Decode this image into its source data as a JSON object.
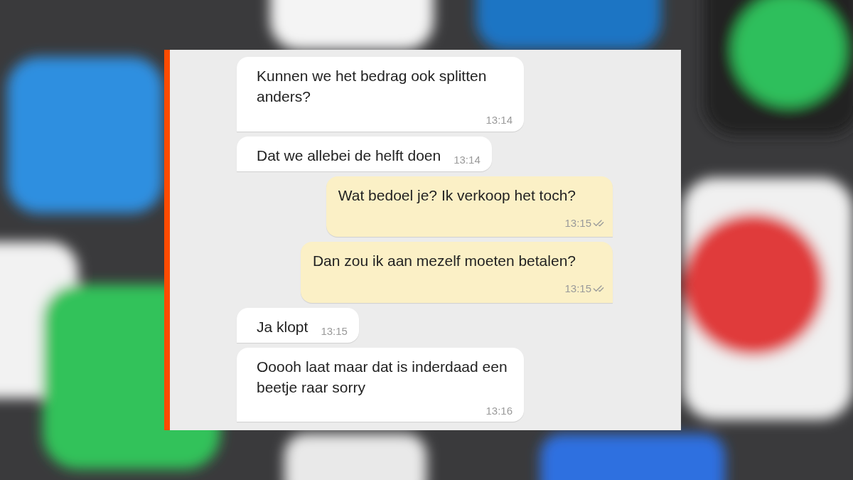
{
  "chat": {
    "messages": [
      {
        "kind": "incoming",
        "text": "Kunnen we het bedrag ook splitten anders?",
        "time": "13:14"
      },
      {
        "kind": "incoming",
        "text": "Dat we allebei de helft doen",
        "time": "13:14"
      },
      {
        "kind": "outgoing",
        "text": "Wat bedoel je? Ik verkoop het toch?",
        "time": "13:15"
      },
      {
        "kind": "outgoing",
        "text": "Dan zou ik aan mezelf moeten betalen?",
        "time": "13:15"
      },
      {
        "kind": "incoming",
        "text": "Ja klopt",
        "time": "13:15"
      },
      {
        "kind": "incoming",
        "text": "Ooooh laat maar dat is inderdaad een beetje raar sorry",
        "time": "13:16"
      }
    ]
  }
}
